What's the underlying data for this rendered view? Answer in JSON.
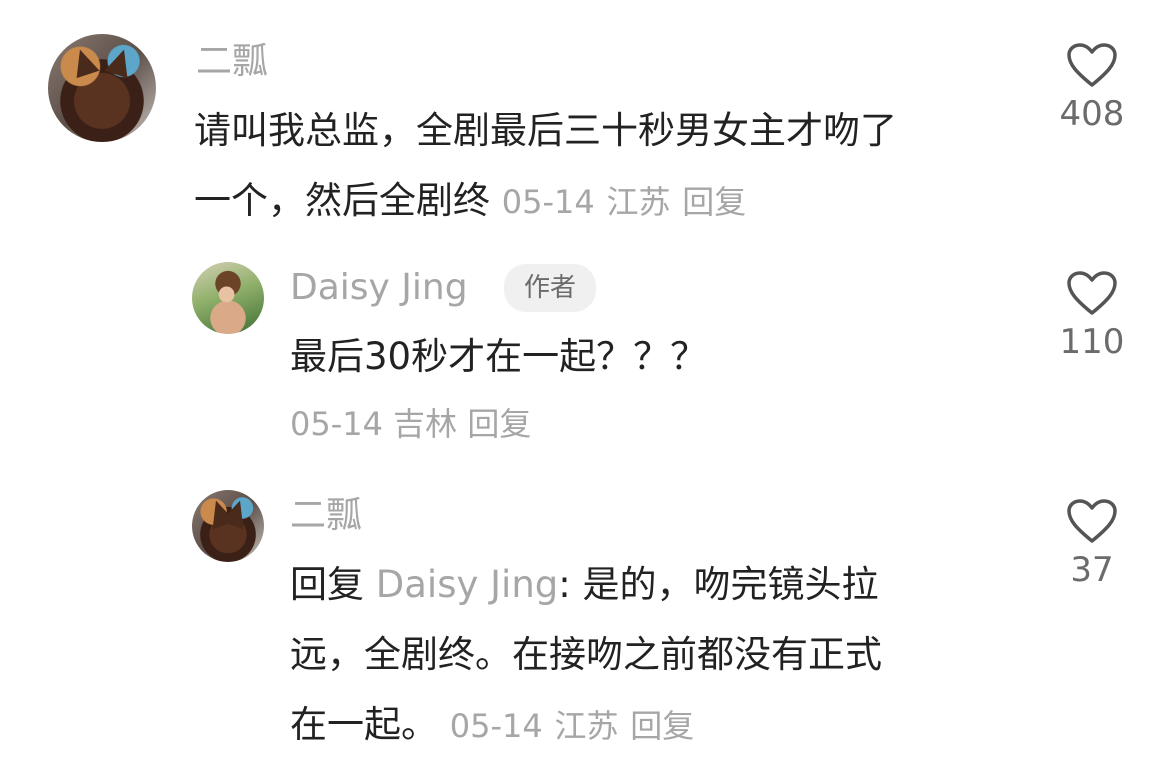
{
  "comments": [
    {
      "username": "二瓢",
      "text": "请叫我总监，全剧最后三十秒男女主才吻了一个，然后全剧终",
      "text_line1": "请叫我总监，全剧最后三十秒男女主才吻了",
      "text_line2": "一个，然后全剧终",
      "date": "05-14",
      "location": "江苏",
      "reply_label": "回复",
      "likes": "408",
      "avatar_icon": "cat-avatar"
    },
    {
      "username": "Daisy Jing",
      "badge": "作者",
      "text": "最后30秒才在一起？？？",
      "date": "05-14",
      "location": "吉林",
      "reply_label": "回复",
      "likes": "110",
      "avatar_icon": "girl-avatar"
    },
    {
      "username": "二瓢",
      "reply_prefix": "回复",
      "reply_to": "Daisy Jing",
      "text_line1": ": 是的，吻完镜头拉",
      "text_line2": "远，全剧终。在接吻之前都没有正式",
      "text_line3": "在一起。",
      "date": "05-14",
      "location": "江苏",
      "reply_label": "回复",
      "likes": "37",
      "avatar_icon": "cat-avatar"
    }
  ],
  "colors": {
    "text": "#222222",
    "muted": "#a6a6a6",
    "badge_bg": "#f0f0f0"
  },
  "icons": {
    "like": "heart-outline-icon"
  }
}
